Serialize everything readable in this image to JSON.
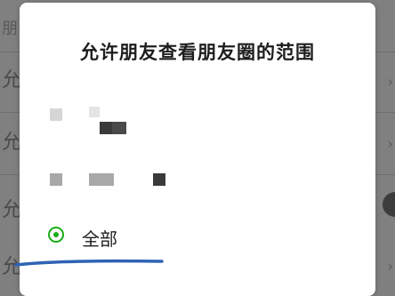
{
  "background": {
    "glyphs": [
      "朋",
      "允",
      "允",
      "允",
      "允"
    ]
  },
  "dialog": {
    "title": "允许朋友查看朋友圈的范围",
    "options": [
      {
        "label": "",
        "obscured": true,
        "selected": false
      },
      {
        "label": "",
        "obscured": true,
        "selected": false
      },
      {
        "label": "全部",
        "obscured": false,
        "selected": true
      }
    ]
  },
  "colors": {
    "radio_accent": "#1aad19",
    "annotation_stroke": "#2f63b3",
    "dialog_bg": "#ffffff",
    "overlay": "#808080"
  }
}
